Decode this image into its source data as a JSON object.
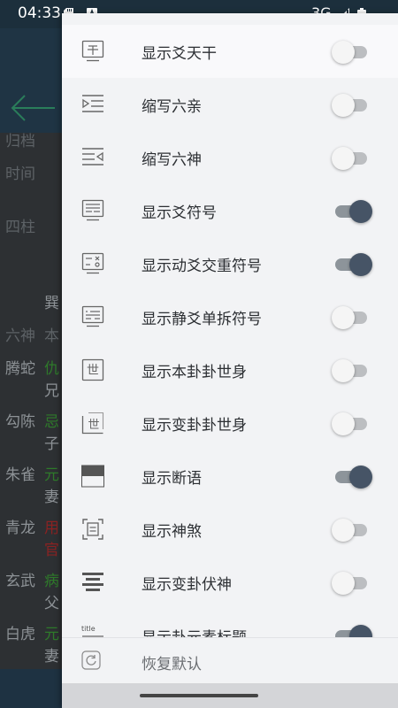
{
  "status_bar": {
    "time": "04:33",
    "network": "3G"
  },
  "background": {
    "labels": [
      "归档",
      "时间",
      "四柱"
    ],
    "gua_name": "巽",
    "column_header": {
      "role": "六神",
      "value": "本"
    },
    "rows": [
      {
        "role": "腾蛇",
        "top": "仇",
        "bottom": "兄"
      },
      {
        "role": "勾陈",
        "top": "忌",
        "bottom": "子"
      },
      {
        "role": "朱雀",
        "top": "元",
        "bottom": "妻"
      },
      {
        "role": "青龙",
        "top": "用",
        "bottom": "官"
      },
      {
        "role": "玄武",
        "top": "病",
        "bottom": "父"
      },
      {
        "role": "白虎",
        "top": "元",
        "bottom": "妻"
      }
    ]
  },
  "drawer": {
    "items": [
      {
        "label": "显示爻天干",
        "on": false
      },
      {
        "label": "缩写六亲",
        "on": false
      },
      {
        "label": "缩写六神",
        "on": false
      },
      {
        "label": "显示爻符号",
        "on": true
      },
      {
        "label": "显示动爻交重符号",
        "on": true
      },
      {
        "label": "显示静爻单拆符号",
        "on": false
      },
      {
        "label": "显示本卦卦世身",
        "on": false,
        "icon_text": "世"
      },
      {
        "label": "显示变卦卦世身",
        "on": false,
        "icon_text": "世"
      },
      {
        "label": "显示断语",
        "on": true
      },
      {
        "label": "显示神煞",
        "on": false
      },
      {
        "label": "显示变卦伏神",
        "on": false
      },
      {
        "label": "显示卦元素标题",
        "on": true,
        "icon_text": "title"
      }
    ],
    "restore_label": "恢复默认"
  },
  "colors": {
    "toggle_on": "#465466",
    "header": "#1f3444",
    "green": "#2e7a2a",
    "red": "#8a2222"
  }
}
